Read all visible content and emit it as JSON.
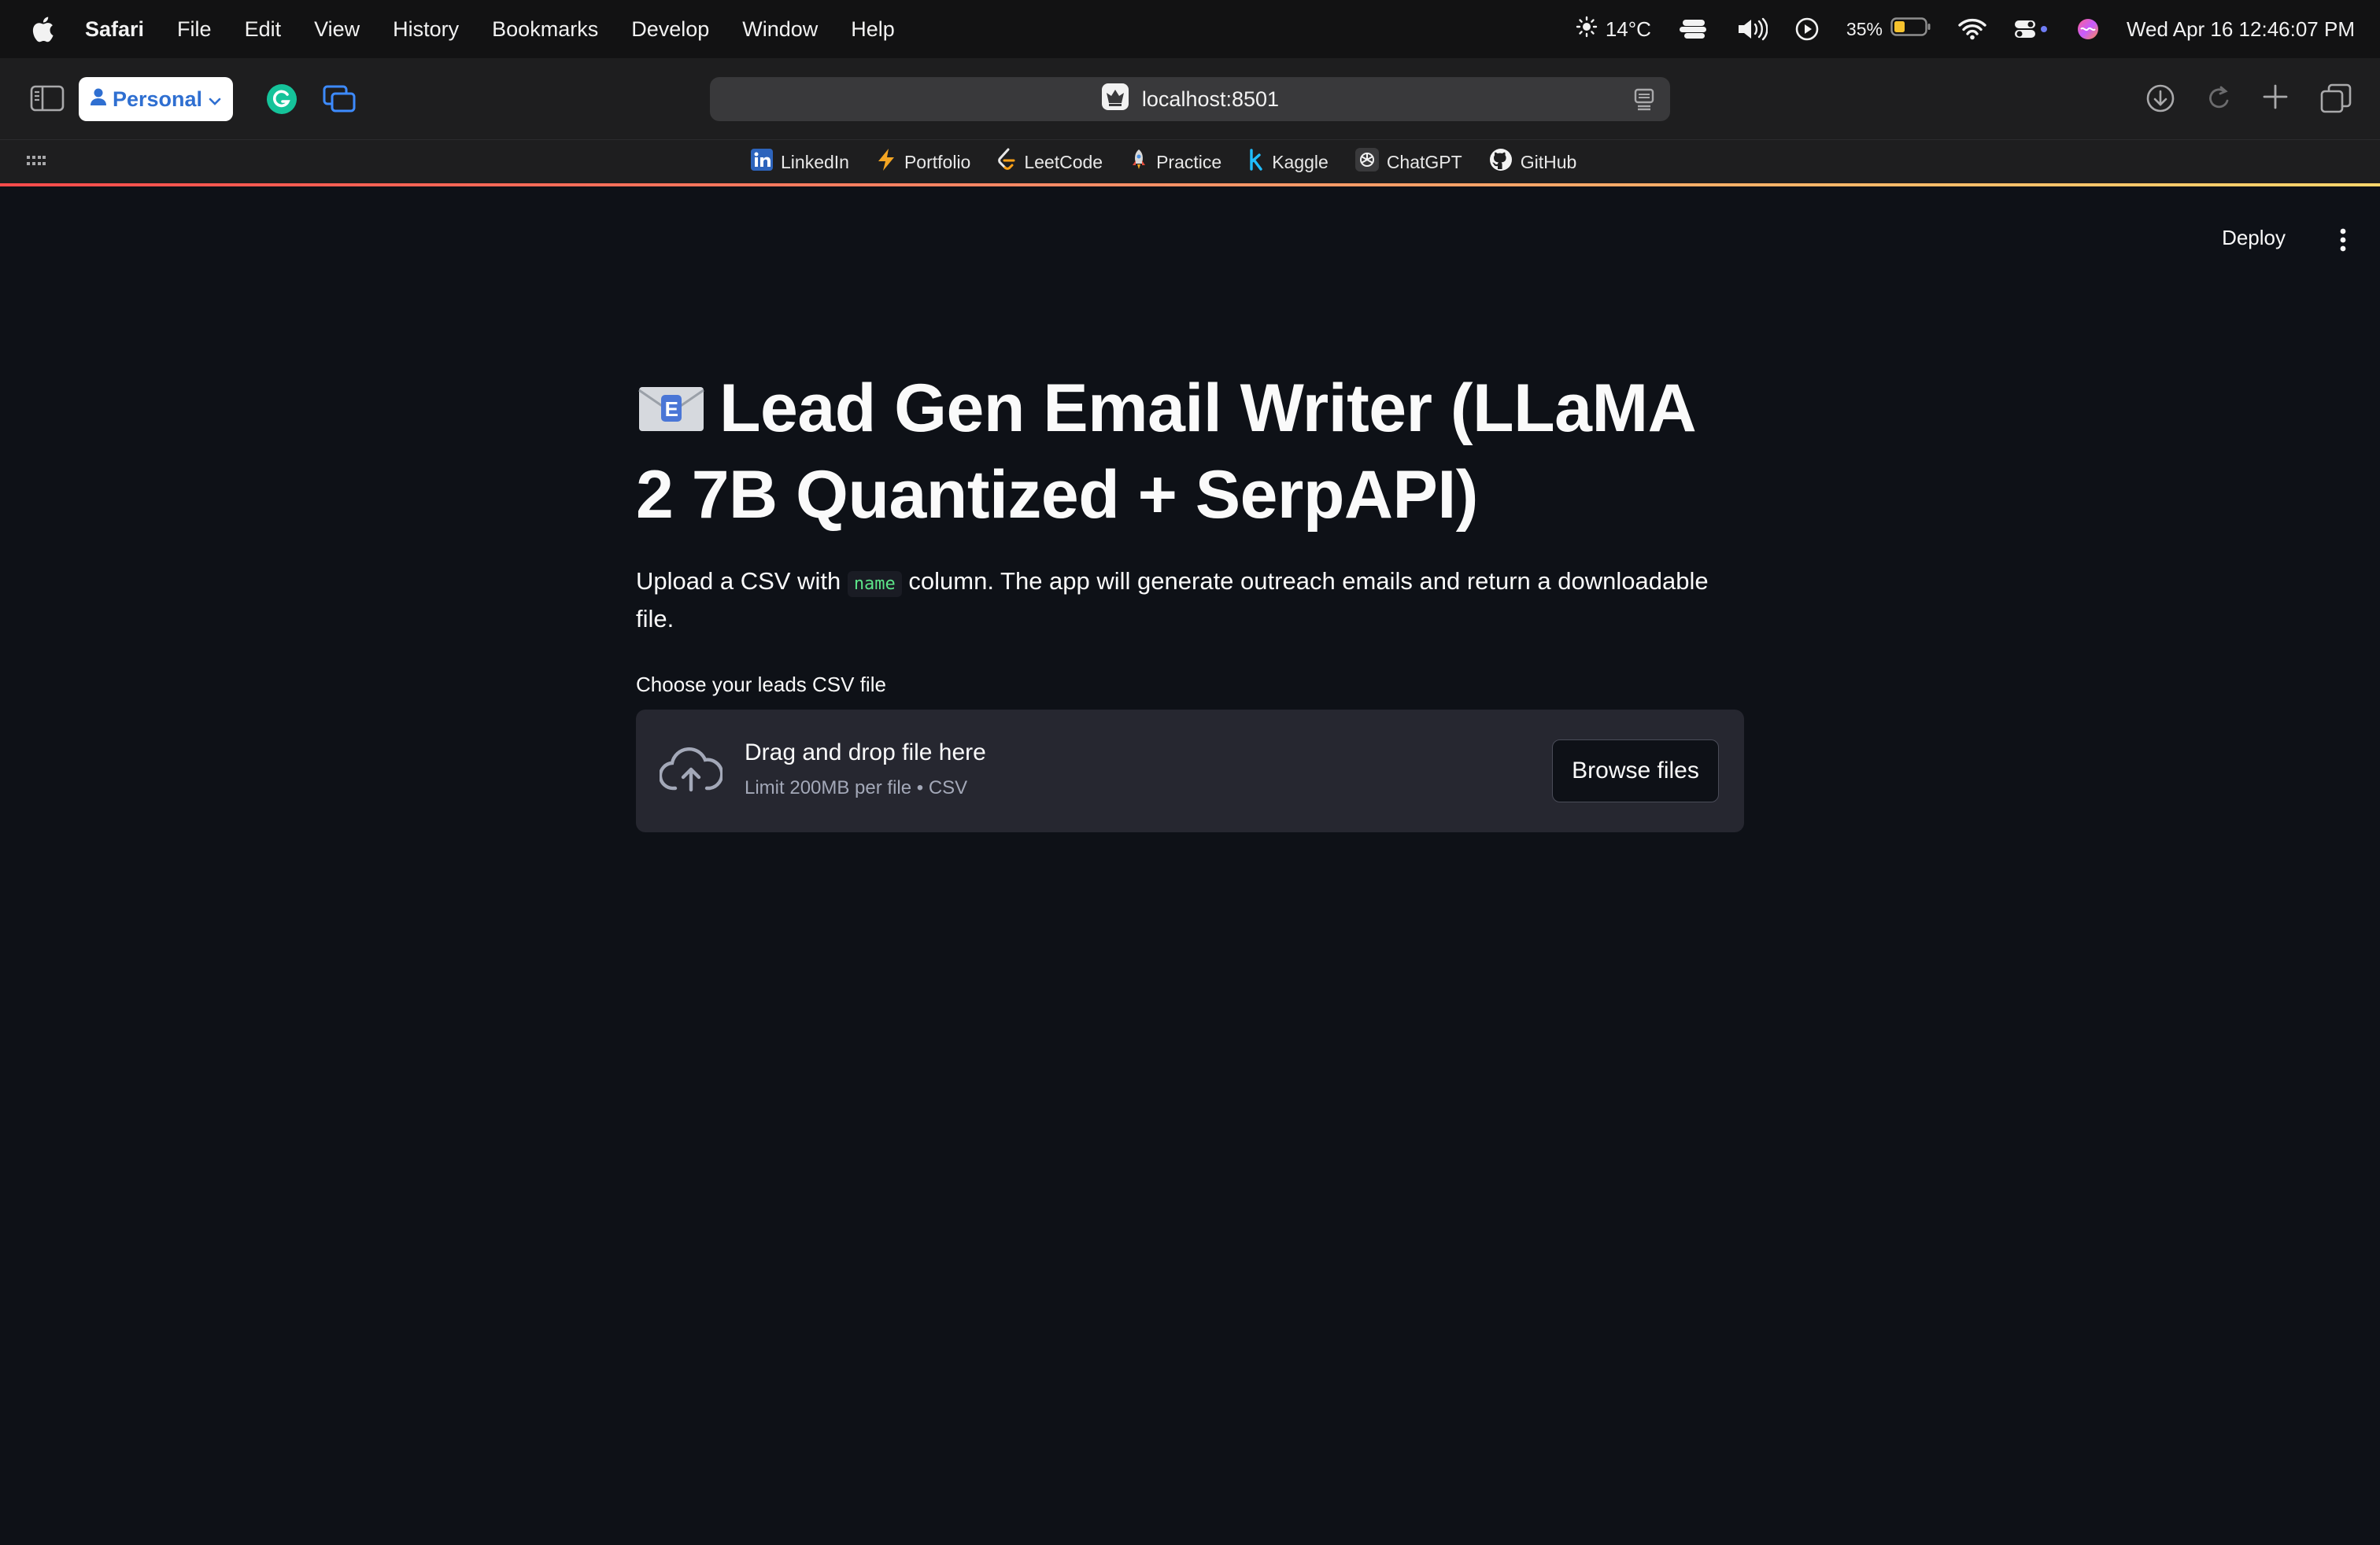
{
  "menubar": {
    "app": "Safari",
    "items": [
      "File",
      "Edit",
      "View",
      "History",
      "Bookmarks",
      "Develop",
      "Window",
      "Help"
    ],
    "weather": "14°C",
    "battery": "35%",
    "datetime": "Wed Apr 16  12:46:07 PM"
  },
  "toolbar": {
    "profile": "Personal",
    "url": "localhost:8501"
  },
  "bookmarks": [
    "LinkedIn",
    "Portfolio",
    "LeetCode",
    "Practice",
    "Kaggle",
    "ChatGPT",
    "GitHub"
  ],
  "app": {
    "deploy": "Deploy",
    "title": "Lead Gen Email Writer (LLaMA 2 7B Quantized + SerpAPI)",
    "intro_before": "Upload a CSV with",
    "intro_code": "name",
    "intro_after": "column. The app will generate outreach emails and return a downloadable file.",
    "uploader_label": "Choose your leads CSV file",
    "drop_text": "Drag and drop file here",
    "limit_text": "Limit 200MB per file • CSV",
    "browse": "Browse files"
  },
  "colors": {
    "page_bg": "#0e1117",
    "dropzone_bg": "#262730",
    "code_text": "#5ce488",
    "profile_text": "#2f6fd1"
  }
}
